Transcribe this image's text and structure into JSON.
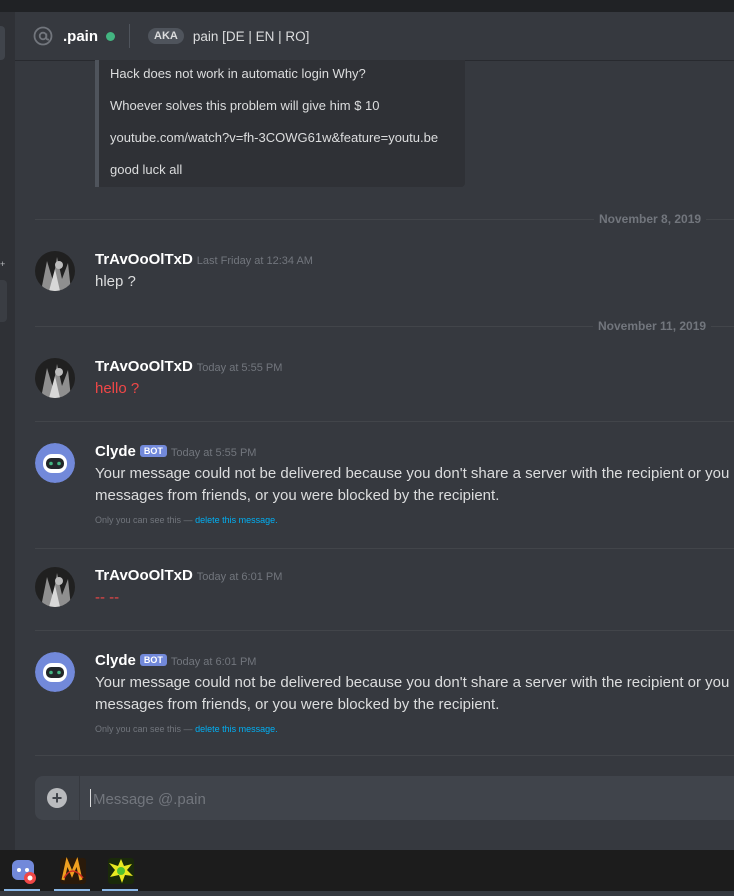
{
  "header": {
    "channel_name": ".pain",
    "aka_label": "AKA",
    "aka_names": "pain [DE | EN | RO]"
  },
  "embed": {
    "lines": [
      "Hack does not work in automatic login Why?",
      "Whoever solves this problem will give him $ 10",
      "youtube.com/watch?v=fh-3COWG61w&feature=youtu.be",
      "good luck all"
    ]
  },
  "dividers": {
    "date1": "November 8, 2019",
    "date2": "November 11, 2019"
  },
  "messages": [
    {
      "author": "TrAvOoOlTxD",
      "timestamp": "Last Friday at 12:34 AM",
      "content": "hlep ?"
    },
    {
      "author": "TrAvOoOlTxD",
      "timestamp": "Today at 5:55 PM",
      "content": "hello ?"
    },
    {
      "author": "Clyde",
      "bot_tag": "BOT",
      "timestamp": "Today at 5:55 PM",
      "line1": "Your message could not be delivered because you don't share a server with the recipient or you d",
      "line2": "messages from friends, or you were blocked by the recipient.",
      "ephemeral_note": "Only you can see this —",
      "ephemeral_link": "delete this message."
    },
    {
      "author": "TrAvOoOlTxD",
      "timestamp": "Today at 6:01 PM",
      "content": "-- --"
    },
    {
      "author": "Clyde",
      "bot_tag": "BOT",
      "timestamp": "Today at 6:01 PM",
      "line1": "Your message could not be delivered because you don't share a server with the recipient or you d",
      "line2": "messages from friends, or you were blocked by the recipient.",
      "ephemeral_note": "Only you can see this —",
      "ephemeral_link": "delete this message."
    }
  ],
  "composer": {
    "placeholder": "Message @.pain"
  },
  "colors": {
    "background": "#36393f",
    "accent": "#7289da",
    "error": "#f04747",
    "link": "#00b0f4",
    "online": "#43b581"
  },
  "icons": [
    "at-icon",
    "plus-icon",
    "discord-app-icon",
    "mu-game-icon",
    "yellow-game-icon"
  ]
}
